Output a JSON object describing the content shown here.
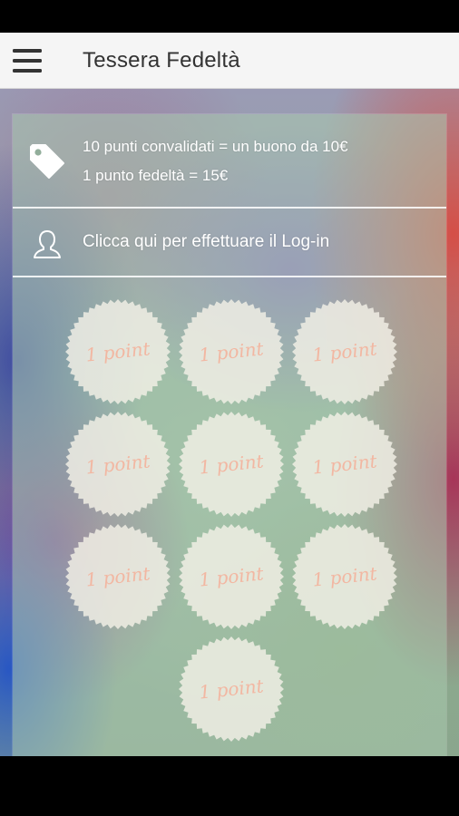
{
  "app_bar": {
    "title": "Tessera Fedeltà",
    "menu_icon": "hamburger-menu-icon"
  },
  "info": {
    "icon": "price-tag-icon",
    "line1": "10 punti convalidati = un buono da 10€",
    "line2": "1 punto fedeltà = 15€"
  },
  "login": {
    "icon": "user-outline-icon",
    "label": "Clicca qui per effettuare il Log-in"
  },
  "stamps": {
    "count": 10,
    "collected": 0,
    "items": [
      {
        "label": "1 point"
      },
      {
        "label": "1 point"
      },
      {
        "label": "1 point"
      },
      {
        "label": "1 point"
      },
      {
        "label": "1 point"
      },
      {
        "label": "1 point"
      },
      {
        "label": "1 point"
      },
      {
        "label": "1 point"
      },
      {
        "label": "1 point"
      },
      {
        "label": "1 point"
      }
    ]
  },
  "colors": {
    "app_bar_bg": "#f5f5f5",
    "stamp_fill": "#f3f0e6",
    "stamp_text": "#f2b7a2",
    "text_on_card": "#ffffff"
  }
}
